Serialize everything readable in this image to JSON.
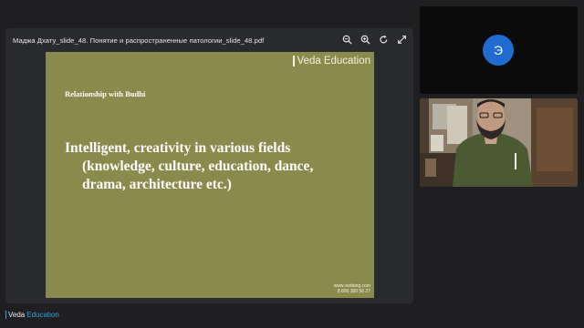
{
  "viewer": {
    "file_title": "Маджа Дхату_slide_48. Понятие и распространенные патологии_slide_48.pdf",
    "tools": [
      "zoom-out-icon",
      "zoom-in-icon",
      "rotate-icon",
      "fullscreen-icon"
    ]
  },
  "slide": {
    "brand_word1": "Veda",
    "brand_word2": "Education",
    "heading": "Relationship with Budhi",
    "body_line1": "Intelligent, creativity in various fields",
    "body_line2": "(knowledge, culture, education, dance,",
    "body_line3": "drama, architecture etc.)",
    "footer_site": "www.vedaing.com",
    "footer_phone": "8 800 300 56 27",
    "background_color": "#8b8a4d"
  },
  "participants": {
    "avatar_initial": "Э",
    "avatar_color": "#1f6bd0"
  },
  "footer_brand": {
    "word1": "Veda",
    "word2": "Education",
    "accent_color": "#2fa3e6"
  }
}
